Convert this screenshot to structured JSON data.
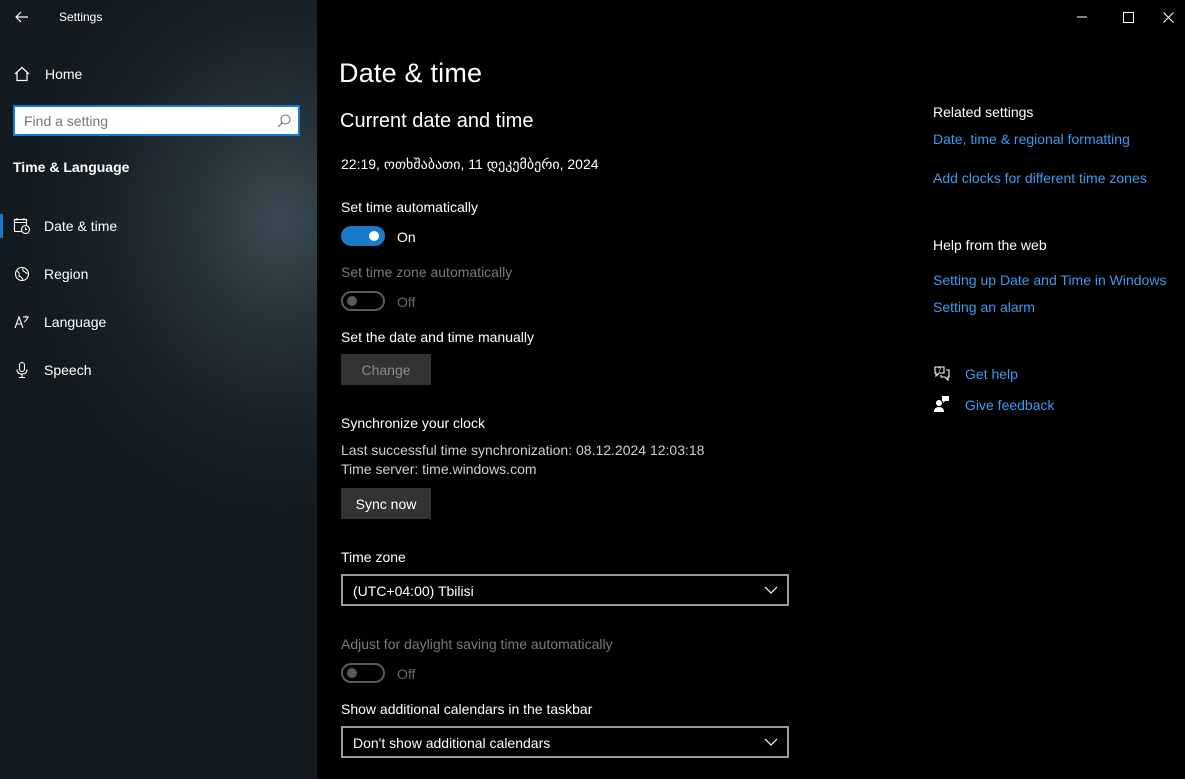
{
  "app": {
    "title": "Settings"
  },
  "sidebar": {
    "home_label": "Home",
    "search_placeholder": "Find a setting",
    "section_title": "Time & Language",
    "items": [
      {
        "label": "Date & time",
        "icon": "calendar-clock-icon",
        "active": true
      },
      {
        "label": "Region",
        "icon": "globe-icon",
        "active": false
      },
      {
        "label": "Language",
        "icon": "language-icon",
        "active": false
      },
      {
        "label": "Speech",
        "icon": "microphone-icon",
        "active": false
      }
    ]
  },
  "main": {
    "page_title": "Date & time",
    "current_heading": "Current date and time",
    "current_datetime": "22:19, ოთხშაბათი, 11 დეკემბერი, 2024",
    "set_time_auto": {
      "label": "Set time automatically",
      "state": "On"
    },
    "set_timezone_auto": {
      "label": "Set time zone automatically",
      "state": "Off"
    },
    "manual": {
      "label": "Set the date and time manually",
      "button": "Change"
    },
    "sync": {
      "heading": "Synchronize your clock",
      "last_sync": "Last successful time synchronization: 08.12.2024 12:03:18",
      "server": "Time server: time.windows.com",
      "button": "Sync now"
    },
    "timezone": {
      "label": "Time zone",
      "value": "(UTC+04:00) Tbilisi"
    },
    "dst": {
      "label": "Adjust for daylight saving time automatically",
      "state": "Off"
    },
    "calendars": {
      "label": "Show additional calendars in the taskbar",
      "value": "Don't show additional calendars"
    }
  },
  "right": {
    "related_title": "Related settings",
    "related_links": [
      "Date, time & regional formatting",
      "Add clocks for different time zones"
    ],
    "web_title": "Help from the web",
    "web_links": [
      "Setting up Date and Time in Windows",
      "Setting an alarm"
    ],
    "get_help": "Get help",
    "give_feedback": "Give feedback"
  },
  "colors": {
    "accent": "#1a79c8",
    "link": "#3b9bed",
    "sidebar_bg": "#1b252c"
  }
}
